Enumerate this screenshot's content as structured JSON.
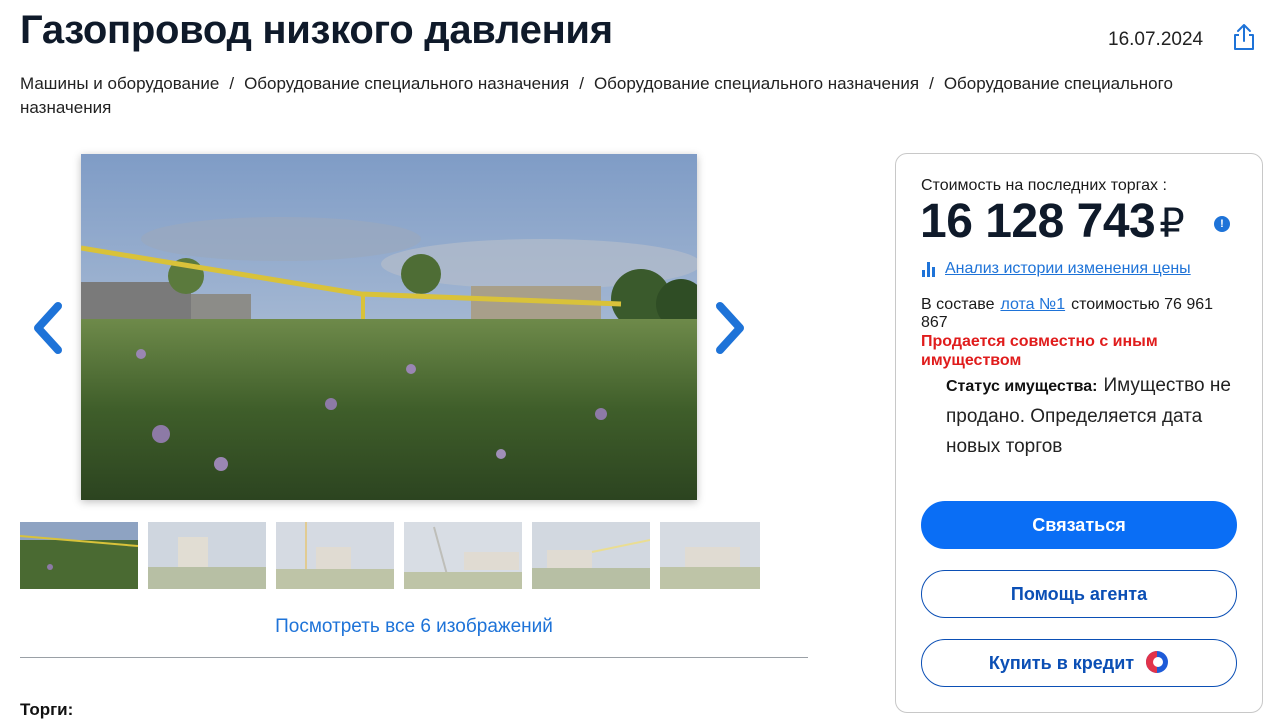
{
  "header": {
    "title": "Газопровод низкого давления",
    "date": "16.07.2024",
    "share_icon": "share-icon"
  },
  "breadcrumb": [
    "Машины и оборудование",
    "Оборудование специального назначения",
    "Оборудование специального назначения",
    "Оборудование специального назначения"
  ],
  "gallery": {
    "view_all_label": "Посмотреть все 6 изображений",
    "thumbnail_count": 6
  },
  "auction_label": "Торги:",
  "price_card": {
    "price_label": "Стоимость на последних торгах :",
    "price_value": "16 128 743",
    "currency": "₽",
    "info_icon": "!",
    "analysis_link": "Анализ истории изменения цены",
    "composition_prefix": "В составе",
    "lot_link": "лота №1",
    "composition_suffix": "стоимостью 76 961 867",
    "joint_sale": "Продается совместно с иным имуществом",
    "status_label": "Статус имущества:",
    "status_value": "Имущество не продано. Определяется дата новых торгов"
  },
  "buttons": {
    "contact": "Связаться",
    "agent_help": "Помощь агента",
    "buy_credit": "Купить в кредит"
  },
  "colors": {
    "accent": "#0a6ef5",
    "link": "#1e73d8",
    "warning": "#e01c1c",
    "title": "#0f1a2a"
  }
}
